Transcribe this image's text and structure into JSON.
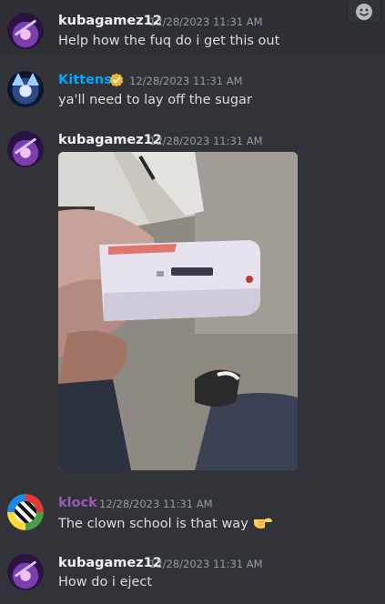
{
  "messages": [
    {
      "author": "kubagamez12",
      "timestamp": "12/28/2023 11:31 AM",
      "text": "Help how the fuq do i get this out"
    },
    {
      "author": "Kittens",
      "timestamp": "12/28/2023 11:31 AM",
      "text": "ya'll need to lay off the sugar",
      "author_color": "#00a8fc"
    },
    {
      "author": "kubagamez12",
      "timestamp": "12/28/2023 11:31 AM"
    },
    {
      "author": "klock",
      "timestamp": "12/28/2023 11:31 AM",
      "text": "The clown school is that way",
      "author_color": "#9b59b6",
      "emoji": "pointing-right-hand"
    },
    {
      "author": "kubagamez12",
      "timestamp": "12/28/2023 11:31 AM",
      "text": "How do i eject"
    }
  ],
  "icons": {
    "add_reaction": "smiley-face-icon",
    "verified": "verified-badge-icon"
  },
  "colors": {
    "background": "#313338",
    "hover_background": "#2e3035",
    "text": "#dbdee1",
    "timestamp": "#949ba4",
    "badge": "#f0b232"
  }
}
